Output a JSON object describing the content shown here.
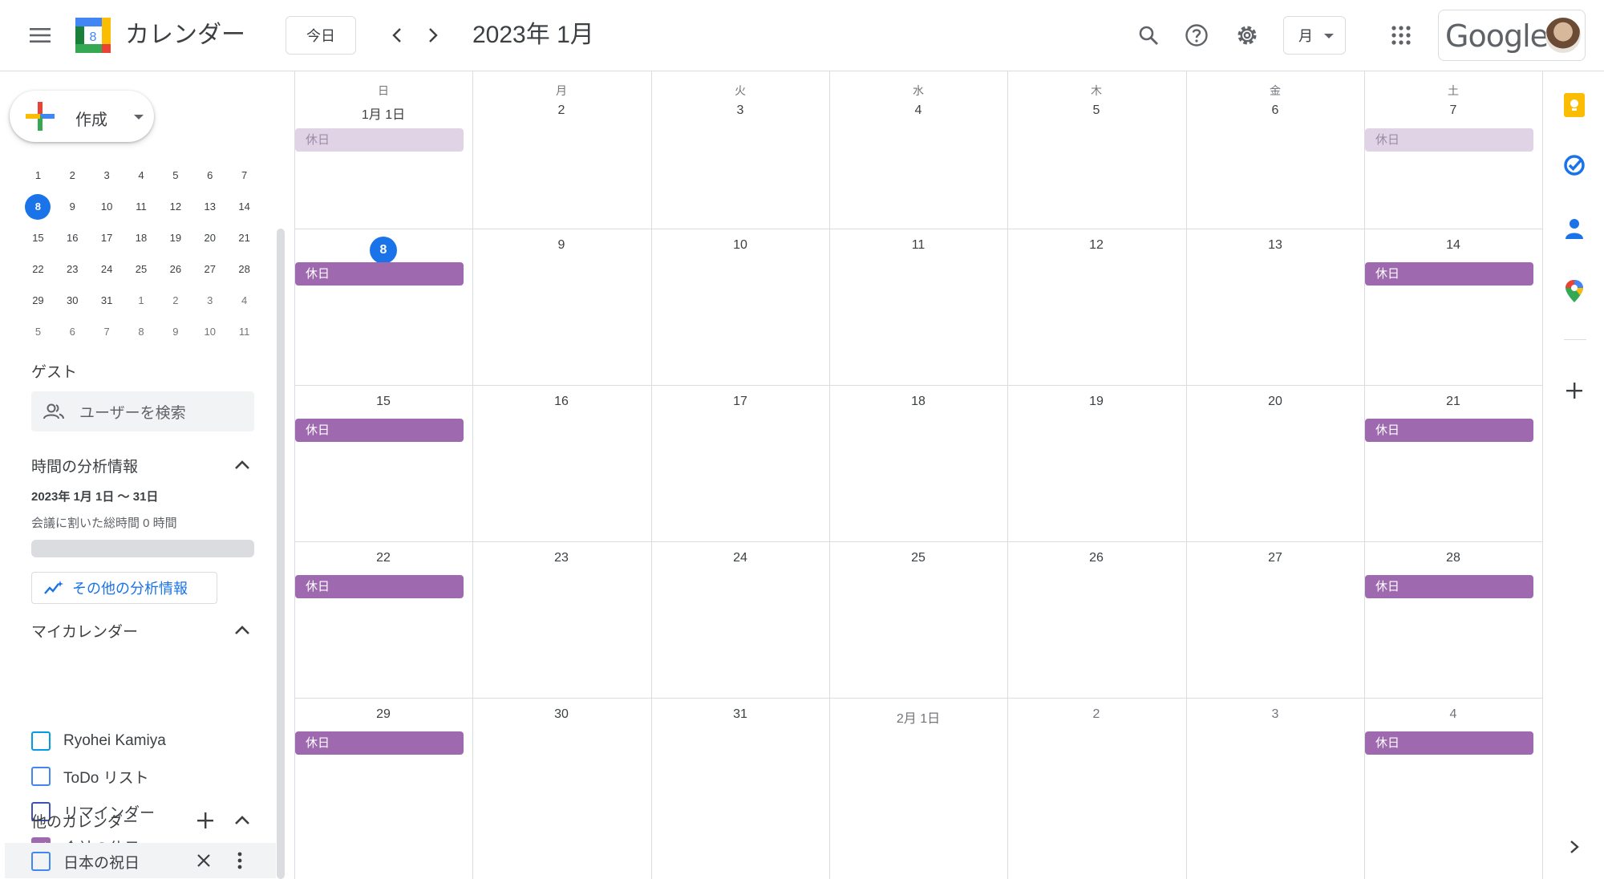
{
  "header": {
    "app_title": "カレンダー",
    "logo_number": "8",
    "today_label": "今日",
    "month_title": "2023年 1月",
    "view_label": "月",
    "google_label": "Google"
  },
  "sidebar": {
    "create_label": "作成",
    "mini_calendar": {
      "rows": [
        [
          "1",
          "2",
          "3",
          "4",
          "5",
          "6",
          "7"
        ],
        [
          "8",
          "9",
          "10",
          "11",
          "12",
          "13",
          "14"
        ],
        [
          "15",
          "16",
          "17",
          "18",
          "19",
          "20",
          "21"
        ],
        [
          "22",
          "23",
          "24",
          "25",
          "26",
          "27",
          "28"
        ],
        [
          "29",
          "30",
          "31",
          "1",
          "2",
          "3",
          "4"
        ],
        [
          "5",
          "6",
          "7",
          "8",
          "9",
          "10",
          "11"
        ]
      ]
    },
    "guest_title": "ゲスト",
    "guest_search_placeholder": "ユーザーを検索",
    "insights_title": "時間の分析情報",
    "insights_range": "2023年 1月 1日 ～ 31日",
    "insights_meeting": "会議に割いた総時間 0 時間",
    "insights_progress": 0,
    "more_insights_label": "その他の分析情報",
    "my_calendars_title": "マイカレンダー",
    "my_calendars": [
      {
        "label": "Ryohei Kamiya",
        "color": "#039be5",
        "checked": false
      },
      {
        "label": "ToDo リスト",
        "color": "#4285f4",
        "checked": false
      },
      {
        "label": "リマインダー",
        "color": "#3f51b5",
        "checked": false
      },
      {
        "label": "会社の休日",
        "color": "#9e69af",
        "checked": true
      }
    ],
    "other_calendars_title": "他のカレンダー",
    "other_calendars": [
      {
        "label": "日本の祝日",
        "color": "#4285f4",
        "checked": false
      }
    ]
  },
  "grid": {
    "weekdays": [
      "日",
      "月",
      "火",
      "水",
      "木",
      "金",
      "土"
    ],
    "weeks": [
      [
        "1月 1日",
        "2",
        "3",
        "4",
        "5",
        "6",
        "7"
      ],
      [
        "8",
        "9",
        "10",
        "11",
        "12",
        "13",
        "14"
      ],
      [
        "15",
        "16",
        "17",
        "18",
        "19",
        "20",
        "21"
      ],
      [
        "22",
        "23",
        "24",
        "25",
        "26",
        "27",
        "28"
      ],
      [
        "29",
        "30",
        "31",
        "2月 1日",
        "2",
        "3",
        "4"
      ]
    ],
    "event_label": "休日"
  },
  "colors": {
    "accent": "#1a73e8",
    "holiday_event": "#9e69af",
    "holiday_event_past": "#e1d3e6"
  }
}
